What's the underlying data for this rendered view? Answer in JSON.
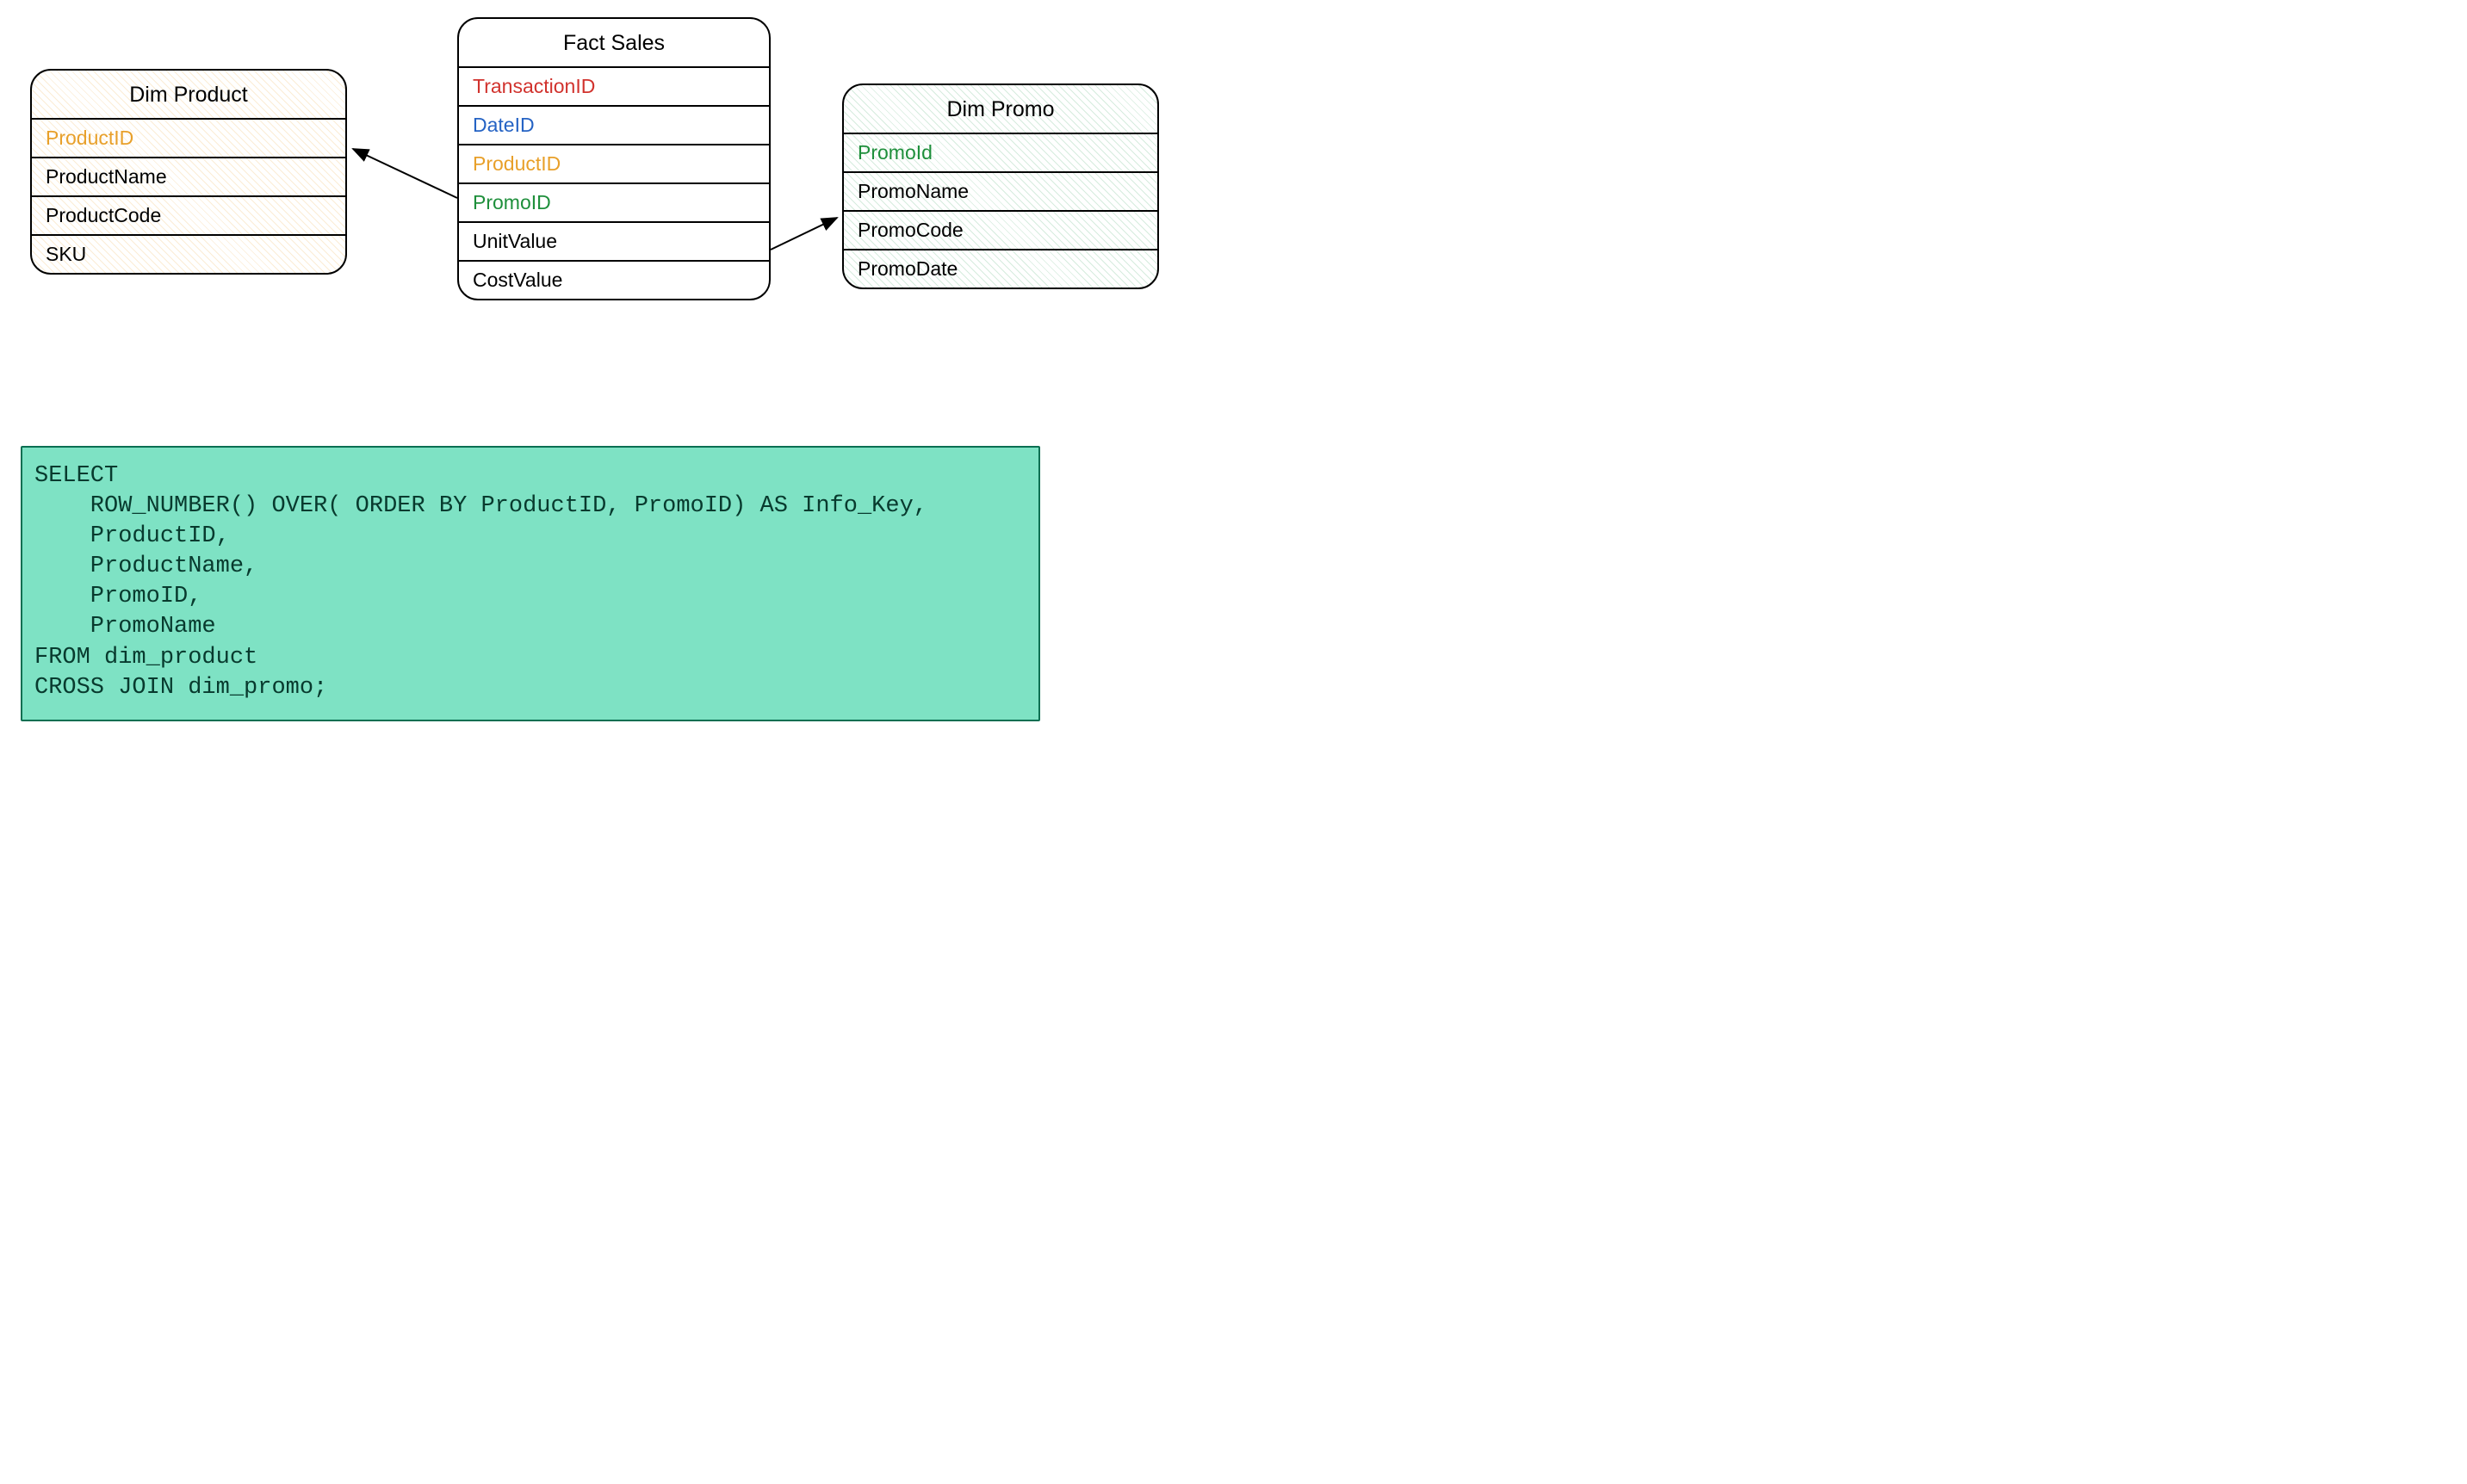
{
  "tables": {
    "dim_product": {
      "title": "Dim Product",
      "columns": [
        {
          "name": "ProductID",
          "color": "clr-orange"
        },
        {
          "name": "ProductName",
          "color": "clr-black"
        },
        {
          "name": "ProductCode",
          "color": "clr-black"
        },
        {
          "name": "SKU",
          "color": "clr-black"
        }
      ]
    },
    "fact_sales": {
      "title": "Fact Sales",
      "columns": [
        {
          "name": "TransactionID",
          "color": "clr-red"
        },
        {
          "name": "DateID",
          "color": "clr-blue"
        },
        {
          "name": "ProductID",
          "color": "clr-orange"
        },
        {
          "name": "PromoID",
          "color": "clr-green"
        },
        {
          "name": "UnitValue",
          "color": "clr-black"
        },
        {
          "name": "CostValue",
          "color": "clr-black"
        }
      ]
    },
    "dim_promo": {
      "title": "Dim Promo",
      "columns": [
        {
          "name": "PromoId",
          "color": "clr-green"
        },
        {
          "name": "PromoName",
          "color": "clr-black"
        },
        {
          "name": "PromoCode",
          "color": "clr-black"
        },
        {
          "name": "PromoDate",
          "color": "clr-black"
        }
      ]
    }
  },
  "arrows": [
    {
      "from": "fact_sales.ProductID",
      "to": "dim_product"
    },
    {
      "from": "fact_sales.PromoID",
      "to": "dim_promo"
    }
  ],
  "sql": "SELECT\n    ROW_NUMBER() OVER( ORDER BY ProductID, PromoID) AS Info_Key,\n    ProductID,\n    ProductName,\n    PromoID,\n    PromoName\nFROM dim_product\nCROSS JOIN dim_promo;"
}
